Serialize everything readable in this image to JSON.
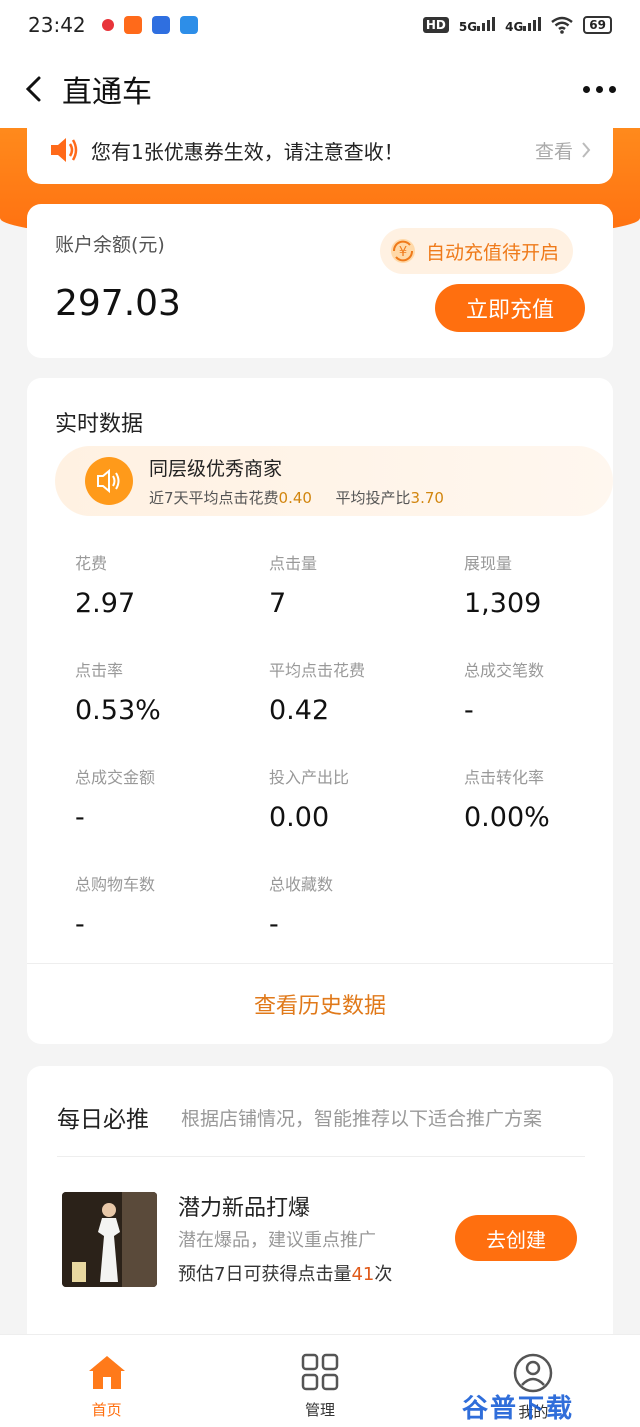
{
  "status_bar": {
    "time": "23:42",
    "battery": "69",
    "network1": "5G",
    "network2": "4G",
    "hd": "HD"
  },
  "nav": {
    "title": "直通车"
  },
  "coupon": {
    "text": "您有1张优惠券生效，请注意查收！",
    "link": "查看"
  },
  "balance": {
    "label": "账户余额(元)",
    "value": "297.03",
    "auto_recharge": "自动充值待开启",
    "recharge_button": "立即充值"
  },
  "realtime": {
    "title": "实时数据",
    "peer": {
      "title": "同层级优秀商家",
      "sub_prefix": "近7天平均点击花费",
      "avg_click_cost": "0.40",
      "roi_prefix": "平均投产比",
      "avg_roi": "3.70"
    },
    "metrics": [
      {
        "label": "花费",
        "value": "2.97"
      },
      {
        "label": "点击量",
        "value": "7"
      },
      {
        "label": "展现量",
        "value": "1,309"
      },
      {
        "label": "点击率",
        "value": "0.53%"
      },
      {
        "label": "平均点击花费",
        "value": "0.42"
      },
      {
        "label": "总成交笔数",
        "value": "-"
      },
      {
        "label": "总成交金额",
        "value": "-"
      },
      {
        "label": "投入产出比",
        "value": "0.00"
      },
      {
        "label": "点击转化率",
        "value": "0.00%"
      },
      {
        "label": "总购物车数",
        "value": "-"
      },
      {
        "label": "总收藏数",
        "value": "-"
      }
    ],
    "history_link": "查看历史数据"
  },
  "daily": {
    "title": "每日必推",
    "subtitle": "根据店铺情况，智能推荐以下适合推广方案",
    "item": {
      "title": "潜力新品打爆",
      "desc": "潜在爆品，建议重点推广",
      "est_prefix": "预估7日可获得点击量",
      "est_value": "41",
      "est_suffix": "次",
      "button": "去创建"
    }
  },
  "tabs": [
    {
      "label": "首页",
      "icon": "home-icon",
      "active": true
    },
    {
      "label": "管理",
      "icon": "grid-icon",
      "active": false
    },
    {
      "label": "我的",
      "icon": "user-icon",
      "active": false
    }
  ],
  "watermark": "谷普下载",
  "colors": {
    "accent": "#ff6f0f",
    "highlight": "#d2860f",
    "link": "#e0791a"
  }
}
